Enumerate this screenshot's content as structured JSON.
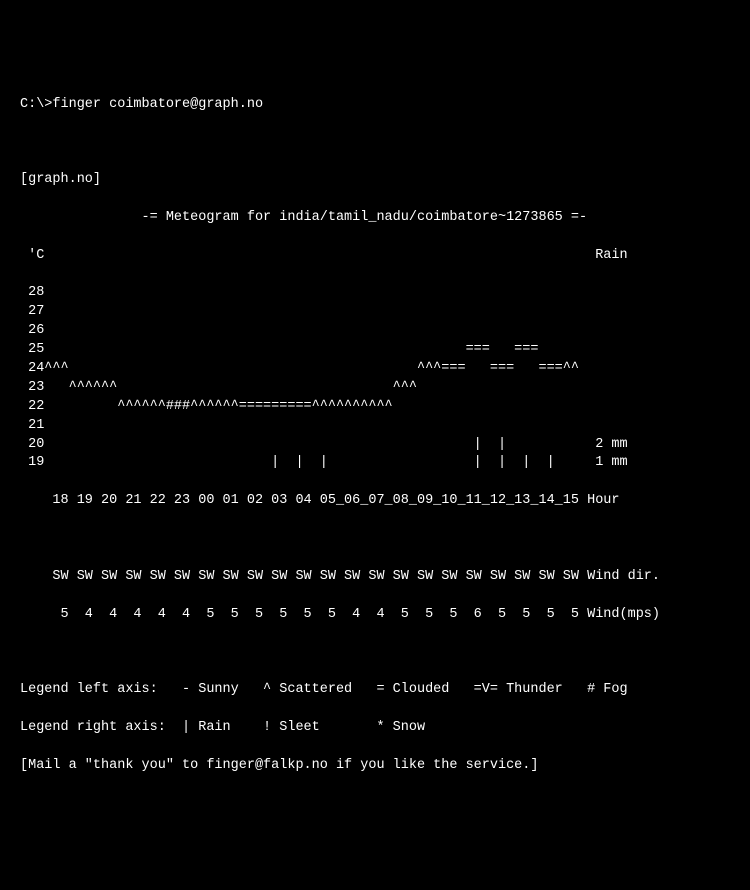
{
  "prompt": "C:\\>finger coimbatore@graph.no",
  "host_header": "[graph.no]",
  "chart_data": {
    "type": "meteogram",
    "title": "-= Meteogram for india/tamil_nadu/coimbatore~1273865 =-",
    "y_axis_left_label": "'C",
    "y_axis_right_label": "Rain",
    "y_ticks": [
      "28",
      "27",
      "26",
      "25",
      "24",
      "23",
      "22",
      "21",
      "20",
      "19"
    ],
    "rain_labels": {
      "20": "2 mm",
      "19": "1 mm"
    },
    "hours": [
      "18",
      "19",
      "20",
      "21",
      "22",
      "23",
      "00",
      "01",
      "02",
      "03",
      "04",
      "05",
      "06",
      "07",
      "08",
      "09",
      "10",
      "11",
      "12",
      "13",
      "14",
      "15"
    ],
    "hours_label": "Hour",
    "temp_rows": {
      "25": "                                                    ===   ===            ",
      "24": "^^^                                           ^^^===   ===   ===^^^      ",
      "23": "   ^^^^^^                                  ^^^                           ",
      "22": "         ^^^^^^###^^^^^^=========^^^^^^^^^^                              "
    },
    "rain_bars": {
      "20": "                                                     |  |           ",
      "19": "                            |  |  |                  |  |  |  |     "
    },
    "cloud_underscores_hours": [
      "06",
      "07",
      "08",
      "09",
      "10",
      "11",
      "12",
      "13",
      "14",
      "15"
    ],
    "wind_dir": [
      "SW",
      "SW",
      "SW",
      "SW",
      "SW",
      "SW",
      "SW",
      "SW",
      "SW",
      "SW",
      "SW",
      "SW",
      "SW",
      "SW",
      "SW",
      "SW",
      "SW",
      "SW",
      "SW",
      "SW",
      "SW",
      "SW"
    ],
    "wind_dir_label": "Wind dir.",
    "wind_mps": [
      5,
      4,
      4,
      4,
      4,
      4,
      5,
      5,
      5,
      5,
      5,
      5,
      4,
      4,
      5,
      5,
      5,
      6,
      5,
      5,
      5,
      5
    ],
    "wind_mps_label": "Wind(mps)"
  },
  "legend": {
    "left": "Legend left axis:   - Sunny   ^ Scattered   = Clouded   =V= Thunder   # Fog",
    "right": "Legend right axis:  | Rain    ! Sleet       * Snow"
  },
  "footer": "[Mail a \"thank you\" to finger@falkp.no if you like the service.]"
}
